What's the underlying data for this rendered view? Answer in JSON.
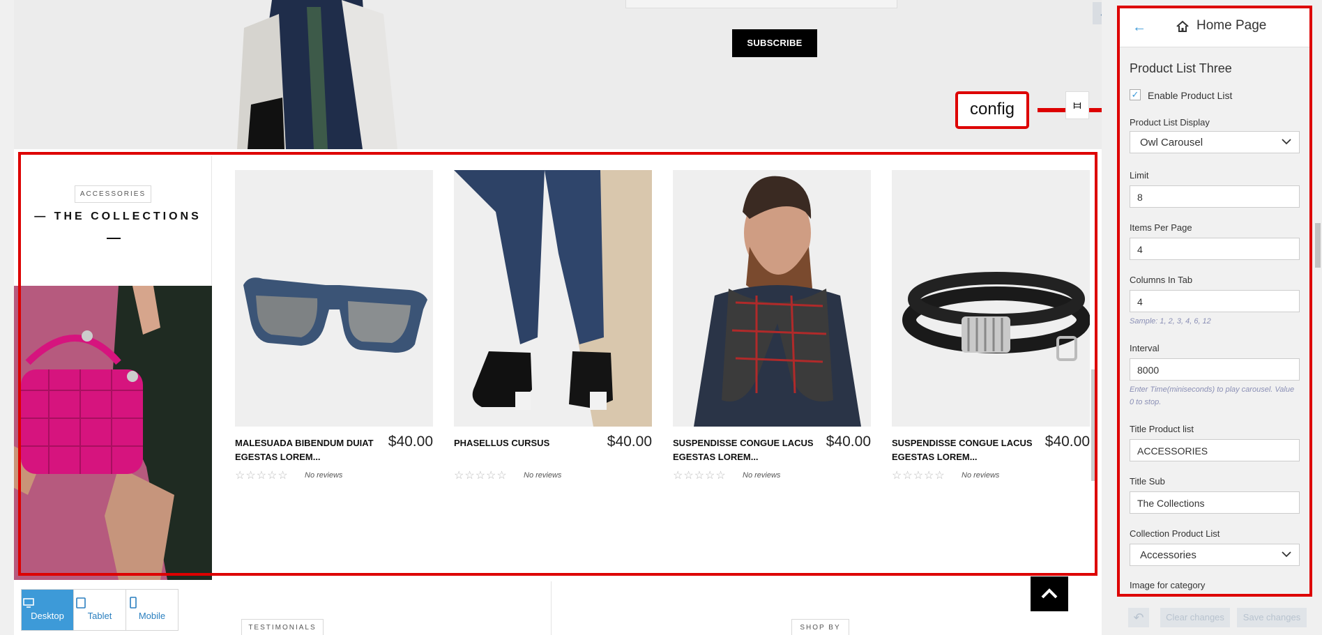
{
  "hero": {
    "subscribe_label": "SUBSCRIBE",
    "expand_icon": "↗"
  },
  "callout": {
    "text": "config",
    "sliders_icon": "⧦"
  },
  "collections": {
    "category_tag": "ACCESSORIES",
    "title": "— THE COLLECTIONS",
    "products": [
      {
        "name": "MALESUADA BIBENDUM DUIAT EGESTAS LOREM...",
        "price": "$40.00",
        "reviews": "No reviews",
        "stars": "☆☆☆☆☆"
      },
      {
        "name": "PHASELLUS CURSUS",
        "price": "$40.00",
        "reviews": "No reviews",
        "stars": "☆☆☆☆☆"
      },
      {
        "name": "SUSPENDISSE CONGUE LACUS EGESTAS LOREM...",
        "price": "$40.00",
        "reviews": "No reviews",
        "stars": "☆☆☆☆☆"
      },
      {
        "name": "SUSPENDISSE CONGUE LACUS EGESTAS LOREM...",
        "price": "$40.00",
        "reviews": "No reviews",
        "stars": "☆☆☆☆☆"
      }
    ]
  },
  "bottom": {
    "testimonials_tag": "TESTIMONIALS",
    "shopby_tag": "SHOP BY",
    "devices": [
      {
        "label": "Desktop",
        "icon": "desktop-icon",
        "active": true
      },
      {
        "label": "Tablet",
        "icon": "tablet-icon",
        "active": false
      },
      {
        "label": "Mobile",
        "icon": "mobile-icon",
        "active": false
      }
    ]
  },
  "panel": {
    "back_icon": "←",
    "title": "Home Page",
    "section_title": "Product List Three",
    "enable_label": "Enable Product List",
    "enable_checked": true,
    "fields": {
      "display_label": "Product List Display",
      "display_value": "Owl Carousel",
      "limit_label": "Limit",
      "limit_value": "8",
      "items_label": "Items Per Page",
      "items_value": "4",
      "columns_label": "Columns In Tab",
      "columns_value": "4",
      "columns_hint": "Sample: 1, 2, 3, 4, 6, 12",
      "interval_label": "Interval",
      "interval_value": "8000",
      "interval_hint": "Enter Time(miniseconds) to play carousel. Value 0 to stop.",
      "title_label": "Title Product list",
      "title_value": "ACCESSORIES",
      "sub_label": "Title Sub",
      "sub_value": "The Collections",
      "collection_label": "Collection Product List",
      "collection_value": "Accessories",
      "image_label": "Image for category"
    },
    "footer": {
      "undo_icon": "↶",
      "clear_label": "Clear changes",
      "save_label": "Save changes"
    }
  },
  "colors": {
    "accent": "#3d9ad8",
    "annotation_red": "#dd0000",
    "promo_pink": "#b65a7e"
  }
}
